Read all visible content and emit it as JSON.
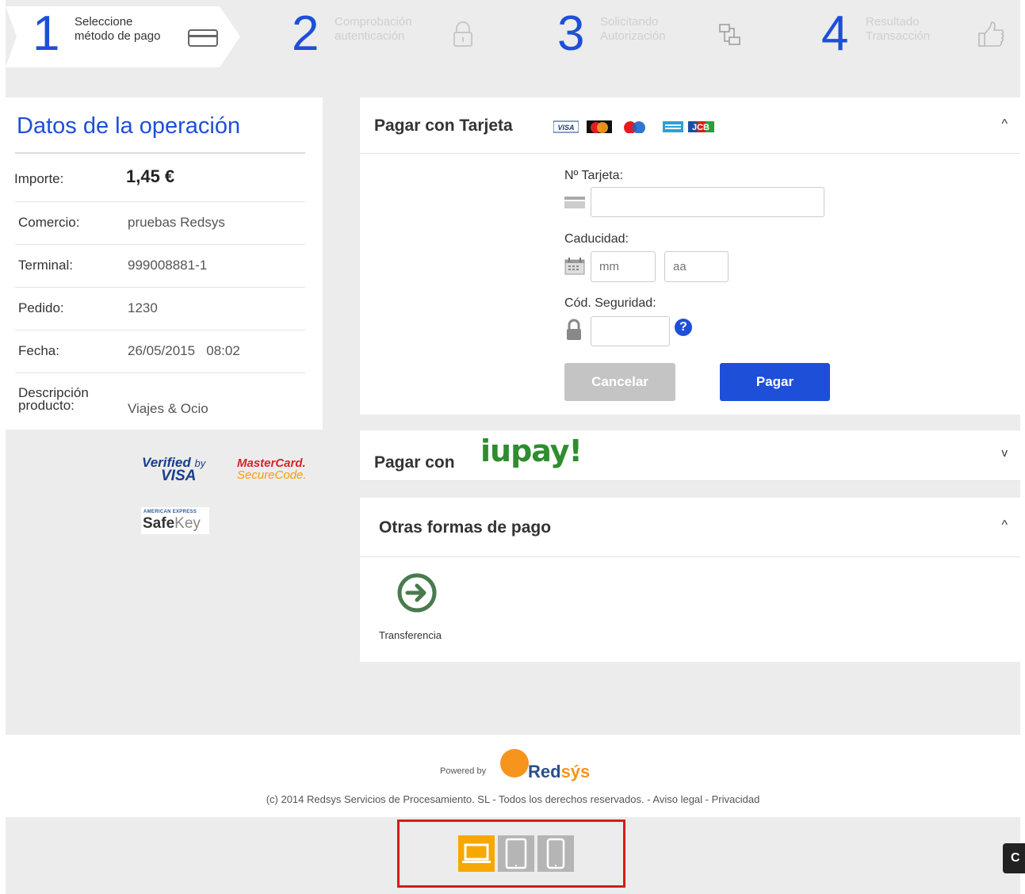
{
  "steps": [
    {
      "number": "1",
      "line1": "Seleccione",
      "line2": "método de pago",
      "icon": "card-icon",
      "active": true
    },
    {
      "number": "2",
      "line1": "Comprobación",
      "line2": "autenticación",
      "icon": "lock-icon",
      "active": false
    },
    {
      "number": "3",
      "line1": "Solicitando",
      "line2": "Autorización",
      "icon": "network-icon",
      "active": false
    },
    {
      "number": "4",
      "line1": "Resultado",
      "line2": "Transacción",
      "icon": "thumbs-up-icon",
      "active": false
    }
  ],
  "operation": {
    "title": "Datos de la operación",
    "rows": [
      {
        "label": "Importe:",
        "value": "1,45 €"
      },
      {
        "label": "Comercio:",
        "value": "pruebas Redsys"
      },
      {
        "label": "Terminal:",
        "value": "999008881-1"
      },
      {
        "label": "Pedido:",
        "value": "1230"
      },
      {
        "label": "Fecha:",
        "value": "26/05/2015   08:02"
      },
      {
        "label_line1": "Descripción",
        "label_line2": "producto:",
        "value": "Viajes & Ocio"
      }
    ]
  },
  "security_logos": {
    "verified_line1": "Verified",
    "verified_by": "by",
    "verified_line2": "VISA",
    "mc_line1": "MasterCard.",
    "mc_line2": "SecureCode.",
    "amex_top": "AMERICAN EXPRESS",
    "safekey_bold": "Safe",
    "safekey_light": "Key"
  },
  "card_payment": {
    "title": "Pagar con Tarjeta",
    "brands": [
      "VISA",
      "MasterCard",
      "Maestro",
      "AmEx",
      "JCB"
    ],
    "card_number_label": "Nº Tarjeta:",
    "card_number_value": "",
    "expiry_label": "Caducidad:",
    "expiry_month_placeholder": "mm",
    "expiry_year_placeholder": "aa",
    "cvv_label": "Cód. Seguridad:",
    "cvv_value": "",
    "help_symbol": "?",
    "cancel_label": "Cancelar",
    "pay_label": "Pagar",
    "chevron": "^"
  },
  "iupay": {
    "title": "Pagar con",
    "logo": "iupay!",
    "chevron": "v"
  },
  "other": {
    "title": "Otras formas de pago",
    "chevron": "^",
    "transfer_label": "Transferencia"
  },
  "footer": {
    "powered_by": "Powered by",
    "brand_main": "Red",
    "brand_accent": "sýs",
    "copyright": "(c) 2014 Redsys Servicios de Procesamiento. SL - Todos los derechos reservados. -  Aviso legal -  Privacidad"
  },
  "devices": [
    "desktop-icon",
    "tablet-icon",
    "mobile-icon"
  ],
  "corner_label": "C",
  "colors": {
    "accent_blue": "#1d4fd8",
    "cancel_gray": "#c4c4c4",
    "device_active": "#f7a800",
    "highlight_red": "#d61c1c",
    "transfer_green": "#4a7a4f"
  }
}
